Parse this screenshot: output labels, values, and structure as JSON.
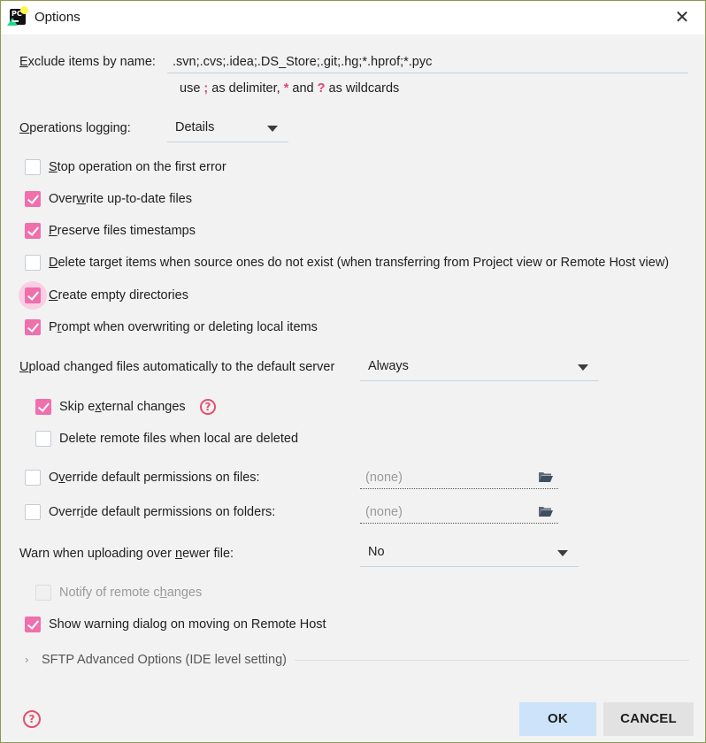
{
  "window": {
    "title": "Options",
    "app_icon": "pycharm-logo-icon",
    "close_icon": "close-icon"
  },
  "exclude": {
    "label_pre": "",
    "label_u": "E",
    "label_post": "xclude items by name:",
    "value": ".svn;.cvs;.idea;.DS_Store;.git;.hg;*.hprof;*.pyc",
    "hint_use": "use",
    "hint_semi": ";",
    "hint_delim": "as delimiter,",
    "hint_star": "*",
    "hint_and": "and",
    "hint_q": "?",
    "hint_wild": "as wildcards"
  },
  "logging": {
    "label_u": "O",
    "label_post": "perations logging:",
    "value": "Details"
  },
  "options": [
    {
      "pre": "",
      "u": "S",
      "post": "top operation on the first error",
      "checked": false
    },
    {
      "pre": "Over",
      "u": "w",
      "post": "rite up-to-date files",
      "checked": true
    },
    {
      "pre": "",
      "u": "P",
      "post": "reserve files timestamps",
      "checked": true
    },
    {
      "pre": "",
      "u": "D",
      "post": "elete target items when source ones do not exist (when transferring from Project view or Remote Host view)",
      "checked": false
    },
    {
      "pre": "",
      "u": "C",
      "post": "reate empty directories",
      "checked": true
    },
    {
      "pre": "P",
      "u": "r",
      "post": "ompt when overwriting or deleting local items",
      "checked": true
    }
  ],
  "upload": {
    "label_pre": "",
    "label_u": "U",
    "label_post": "pload changed files automatically to the default server",
    "value": "Always",
    "skip_pre": "Skip e",
    "skip_u": "x",
    "skip_post": "ternal changes",
    "skip_checked": true,
    "delete_remote_label": "Delete remote files when local are deleted",
    "delete_remote_checked": false
  },
  "permissions": {
    "files_pre": "O",
    "files_u": "v",
    "files_post": "erride default permissions on files:",
    "files_value": "(none)",
    "folders_pre": "Overr",
    "folders_u": "i",
    "folders_post": "de default permissions on folders:",
    "folders_value": "(none)"
  },
  "warn": {
    "label_pre": "Warn when uploading over ",
    "label_u": "n",
    "label_post": "ewer file:",
    "value": "No"
  },
  "notify": {
    "pre": "Notify of remote c",
    "u": "h",
    "post": "anges",
    "checked": false
  },
  "show_warning": {
    "label": "Show warning dialog on moving on Remote Host",
    "checked": true
  },
  "sftp_section": {
    "label": "SFTP Advanced Options (IDE level setting)"
  },
  "footer": {
    "help_icon": "help-icon",
    "ok_label": "OK",
    "cancel_label": "CANCEL"
  },
  "colors": {
    "accent": "#f06fad",
    "ok_bg": "#cde3f9",
    "cancel_bg": "#e2e2e2",
    "panel_bg": "#f2f2f2"
  }
}
